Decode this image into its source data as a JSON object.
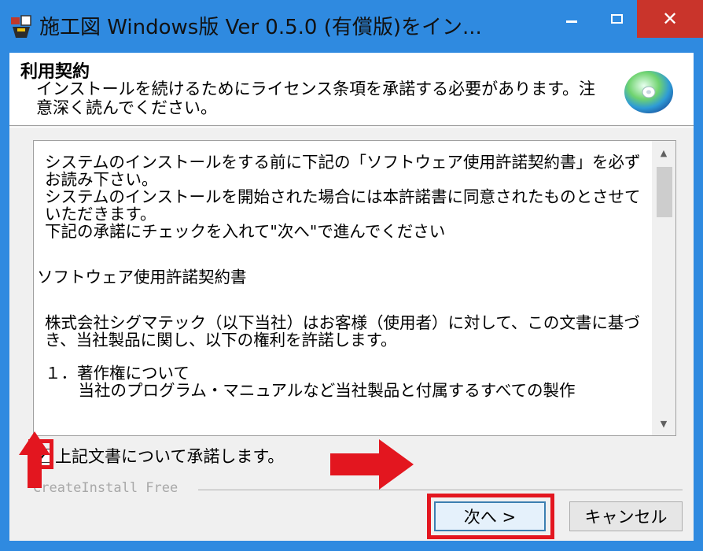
{
  "window": {
    "title": "施工図 Windows版 Ver 0.5.0 (有償版)をイン...",
    "icon": "installer-app-icon",
    "controls": {
      "minimize": "minimize-icon",
      "maximize": "maximize-icon",
      "close": "close-icon"
    },
    "close_label": "✕"
  },
  "header": {
    "title": "利用契約",
    "description": "インストールを続けるためにライセンス条項を承諾する必要があります。注意深く読んでください。",
    "icon": "cd-disc-icon"
  },
  "license": {
    "paragraphs": [
      "システムのインストールをする前に下記の「ソフトウェア使用許諾契約書」を必ずお読み下さい。",
      "システムのインストールを開始された場合には本許諾書に同意されたものとさせていただきます。",
      "下記の承諾にチェックを入れて\"次へ\"で進んでください",
      "ソフトウェア使用許諾契約書",
      "株式会社シグマテック（以下当社）はお客様（使用者）に対して、この文書に基づき、当社製品に関し、以下の権利を許諾します。",
      "１．著作権について",
      "　当社のプログラム・マニュアルなど当社製品と付属するすべての製作"
    ]
  },
  "scrollbar": {
    "up": "▲",
    "down": "▼"
  },
  "agreement": {
    "label": "上記文書について承諾します。",
    "checked": true,
    "checkmark": "✔"
  },
  "branding": "CreateInstall Free",
  "buttons": {
    "next": "次へ >",
    "cancel": "キャンセル"
  },
  "annotations": {
    "highlight_color": "#e3161f"
  }
}
